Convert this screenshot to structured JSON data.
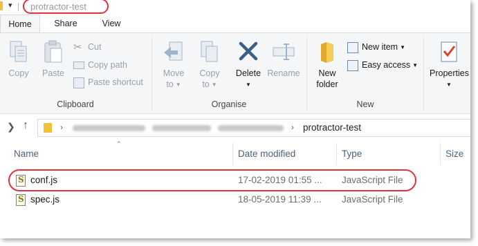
{
  "window": {
    "title": "protractor-test"
  },
  "tabs": [
    {
      "label": "Home",
      "active": true
    },
    {
      "label": "Share",
      "active": false
    },
    {
      "label": "View",
      "active": false
    }
  ],
  "ribbon": {
    "clipboard": {
      "label": "Clipboard",
      "copy": "Copy",
      "paste": "Paste",
      "cut": "Cut",
      "copy_path": "Copy path",
      "paste_shortcut": "Paste shortcut"
    },
    "organise": {
      "label": "Organise",
      "move_to_1": "Move",
      "move_to_2": "to",
      "copy_to_1": "Copy",
      "copy_to_2": "to",
      "delete": "Delete",
      "rename": "Rename"
    },
    "new": {
      "label": "New",
      "new_folder_1": "New",
      "new_folder_2": "folder",
      "new_item": "New item",
      "easy_access": "Easy access"
    },
    "open": {
      "properties": "Properties"
    }
  },
  "address": {
    "current": "protractor-test"
  },
  "columns": {
    "name": "Name",
    "date_modified": "Date modified",
    "type": "Type",
    "size": "Size"
  },
  "files": [
    {
      "name": "conf.js",
      "date": "17-02-2019 01:55 ...",
      "type": "JavaScript File"
    },
    {
      "name": "spec.js",
      "date": "18-05-2019 11:39 ...",
      "type": "JavaScript File"
    }
  ],
  "colors": {
    "highlight": "#e0313d",
    "folder": "#f0c23a",
    "column_header": "#4c607a"
  }
}
